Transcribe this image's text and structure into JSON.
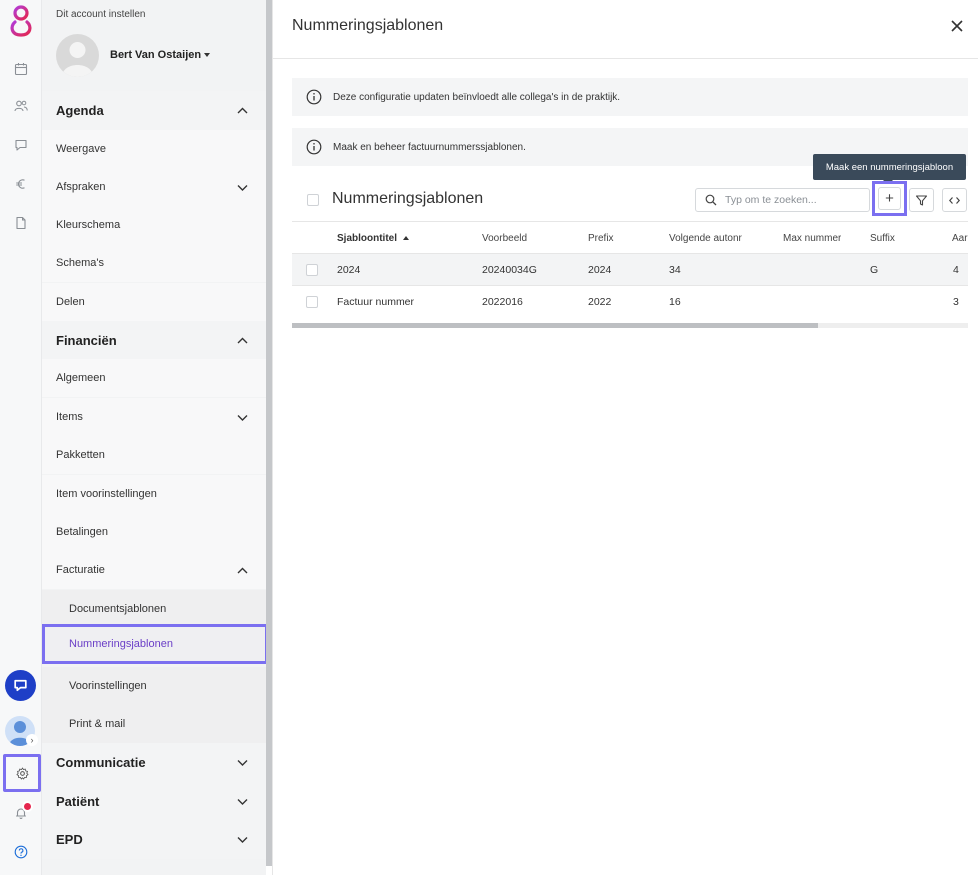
{
  "account": {
    "setup_label": "Dit account instellen",
    "user_name": "Bert Van Ostaijen"
  },
  "sidebar": {
    "agenda": {
      "label": "Agenda",
      "items": [
        "Weergave",
        "Afspraken",
        "Kleurschema",
        "Schema's",
        "Delen"
      ]
    },
    "financien": {
      "label": "Financiën",
      "items": [
        "Algemeen",
        "Items",
        "Pakketten",
        "Item voorinstellingen",
        "Betalingen",
        "Facturatie"
      ],
      "facturatie_sub": [
        "Documentsjablonen",
        "Nummeringsjablonen",
        "Voorinstellingen",
        "Print & mail"
      ]
    },
    "communicatie": {
      "label": "Communicatie"
    },
    "patient": {
      "label": "Patiënt"
    },
    "epd": {
      "label": "EPD"
    }
  },
  "main": {
    "title": "Nummeringsjablonen",
    "info_1": "Deze configuratie updaten beïnvloedt alle collega's in de praktijk.",
    "info_2": "Maak en beheer factuurnummerssjablonen.",
    "grid_title": "Nummeringsjablonen",
    "search_placeholder": "Typ om te zoeken...",
    "add_tooltip": "Maak een nummeringsjabloon",
    "add_glyph": "+",
    "columns": [
      "Sjabloontitel",
      "Voorbeeld",
      "Prefix",
      "Volgende autonr",
      "Max nummer",
      "Suffix",
      "Aar"
    ],
    "rows": [
      [
        "2024",
        "20240034G",
        "2024",
        "34",
        "",
        "G",
        "4"
      ],
      [
        "Factuur nummer",
        "2022016",
        "2022",
        "16",
        "",
        "",
        "3"
      ]
    ]
  },
  "colors": {
    "accent": "#7b6ff0",
    "active_text": "#6b3fc7",
    "chat_button": "#1e3fc7",
    "notification_badge": "#e5264e",
    "tooltip_bg": "#3a4a5a"
  },
  "icons": [
    "app-logo-icon",
    "calendar-icon",
    "users-icon",
    "chat-icon",
    "euro-icon",
    "document-icon",
    "support-chat-icon",
    "gear-icon",
    "bell-icon",
    "help-icon",
    "info-icon",
    "search-icon",
    "plus-icon",
    "filter-icon",
    "code-icon",
    "close-icon",
    "chevron-up-icon",
    "chevron-down-icon"
  ]
}
